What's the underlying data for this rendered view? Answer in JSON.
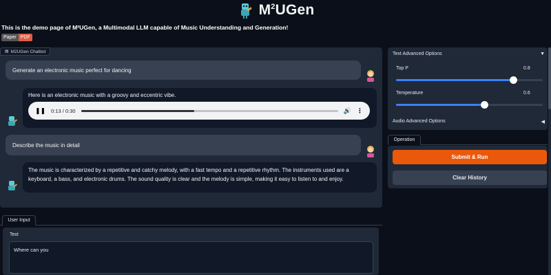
{
  "header": {
    "title_prefix": "M",
    "title_sup": "2",
    "title_suffix": "UGen",
    "description": "This is the demo page of M²UGen, a Multimodal LLM capable of Music Understanding and Generation!",
    "badge_left": "Paper",
    "badge_right": "PDF"
  },
  "chatbot": {
    "label": "M2UGen Chatbot",
    "messages": [
      {
        "role": "user",
        "text": "Generate an electronic music perfect for dancing"
      },
      {
        "role": "bot",
        "text": "Here is an electronic music with a groovy and eccentric vibe.",
        "audio": {
          "time": "0:13 / 0:30",
          "progress": 0.44
        }
      },
      {
        "role": "user",
        "text": "Describe the music in detail"
      },
      {
        "role": "bot",
        "text": "The music is characterized by a repetitive and catchy melody, with a fast tempo and a repetitive rhythm. The instruments used are a keyboard, a bass, and electronic drums. The sound quality is clear and the melody is simple, making it easy to listen to and enjoy."
      }
    ]
  },
  "user_input": {
    "tab_label": "User Input",
    "field_label": "Text",
    "value": "Where can you"
  },
  "options": {
    "text_title": "Text Advanced Options",
    "text_arrow": "▼",
    "top_p": {
      "label": "Top P",
      "value": 0.8,
      "min": 0,
      "max": 1
    },
    "temperature": {
      "label": "Temperature",
      "value": 0.6,
      "min": 0,
      "max": 1
    },
    "audio_title": "Audio Advanced Options",
    "audio_arrow": "◀"
  },
  "operation": {
    "tab_label": "Operation",
    "submit_label": "Submit & Run",
    "clear_label": "Clear History"
  },
  "colors": {
    "accent": "#ea580c",
    "slider": "#3b82f6",
    "background": "#0b0f19",
    "panel": "#1f2937"
  },
  "icons": {
    "logo": "robot-guitar-icon",
    "user_avatar": "girl-avatar-icon",
    "bot_avatar": "robot-avatar-icon"
  }
}
